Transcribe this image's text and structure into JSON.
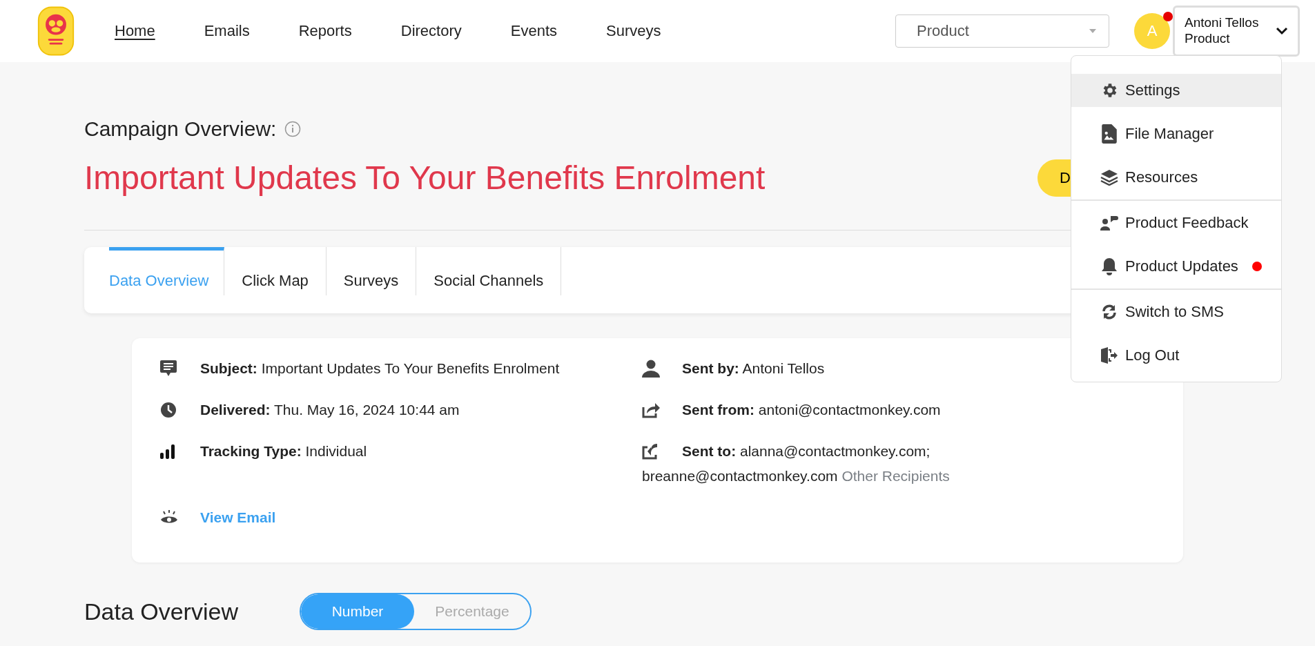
{
  "header": {
    "nav": [
      {
        "label": "Home",
        "selected": true
      },
      {
        "label": "Emails",
        "selected": false
      },
      {
        "label": "Reports",
        "selected": false
      },
      {
        "label": "Directory",
        "selected": false
      },
      {
        "label": "Events",
        "selected": false
      },
      {
        "label": "Surveys",
        "selected": false
      }
    ],
    "org_select": {
      "value": "Product"
    },
    "user": {
      "initial": "A",
      "unread": true,
      "name": "Antoni Tellos",
      "org": "Product"
    }
  },
  "user_menu": {
    "groups": [
      [
        {
          "kind": "settings",
          "label": "Settings",
          "highlighted": true,
          "unread": false
        },
        {
          "kind": "file",
          "label": "File Manager",
          "highlighted": false,
          "unread": false
        },
        {
          "kind": "resources",
          "label": "Resources",
          "highlighted": false,
          "unread": false
        }
      ],
      [
        {
          "kind": "feedback",
          "label": "Product Feedback",
          "highlighted": false,
          "unread": false
        },
        {
          "kind": "updates",
          "label": "Product Updates",
          "highlighted": false,
          "unread": true
        }
      ],
      [
        {
          "kind": "switch",
          "label": "Switch to SMS",
          "highlighted": false,
          "unread": false
        },
        {
          "kind": "logout",
          "label": "Log Out",
          "highlighted": false,
          "unread": false
        }
      ]
    ]
  },
  "campaign": {
    "label": "Campaign Overview:",
    "title": "Important Updates To Your Benefits Enrolment",
    "action_button": "D"
  },
  "tabs": [
    {
      "label": "Data Overview",
      "selected": true
    },
    {
      "label": "Click Map",
      "selected": false
    },
    {
      "label": "Surveys",
      "selected": false
    },
    {
      "label": "Social Channels",
      "selected": false
    }
  ],
  "details": {
    "left": [
      {
        "kind": "subject",
        "label": "Subject:",
        "lines": [
          "Important Updates To Your Benefits Enrolment"
        ]
      },
      {
        "kind": "delivered",
        "label": "Delivered:",
        "lines": [
          "Thu. May 16, 2024 10:44 am"
        ]
      },
      {
        "kind": "tracking",
        "label": "Tracking Type:",
        "lines": [
          "Individual"
        ]
      }
    ],
    "right": [
      {
        "kind": "sender",
        "label": "Sent by:",
        "lines": [
          "Antoni Tellos"
        ]
      },
      {
        "kind": "from",
        "label": "Sent from:",
        "lines": [
          "antoni@contactmonkey.com"
        ]
      },
      {
        "kind": "to",
        "label": "Sent to:",
        "lines": [
          "alanna@contactmonkey.com;",
          "breanne@contactmonkey.com"
        ],
        "link": "Other Recipients"
      }
    ],
    "view_link": "View Email"
  },
  "data_overview": {
    "heading": "Data Overview",
    "toggle": [
      {
        "label": "Number",
        "selected": true
      },
      {
        "label": "Percentage",
        "selected": false
      }
    ]
  }
}
